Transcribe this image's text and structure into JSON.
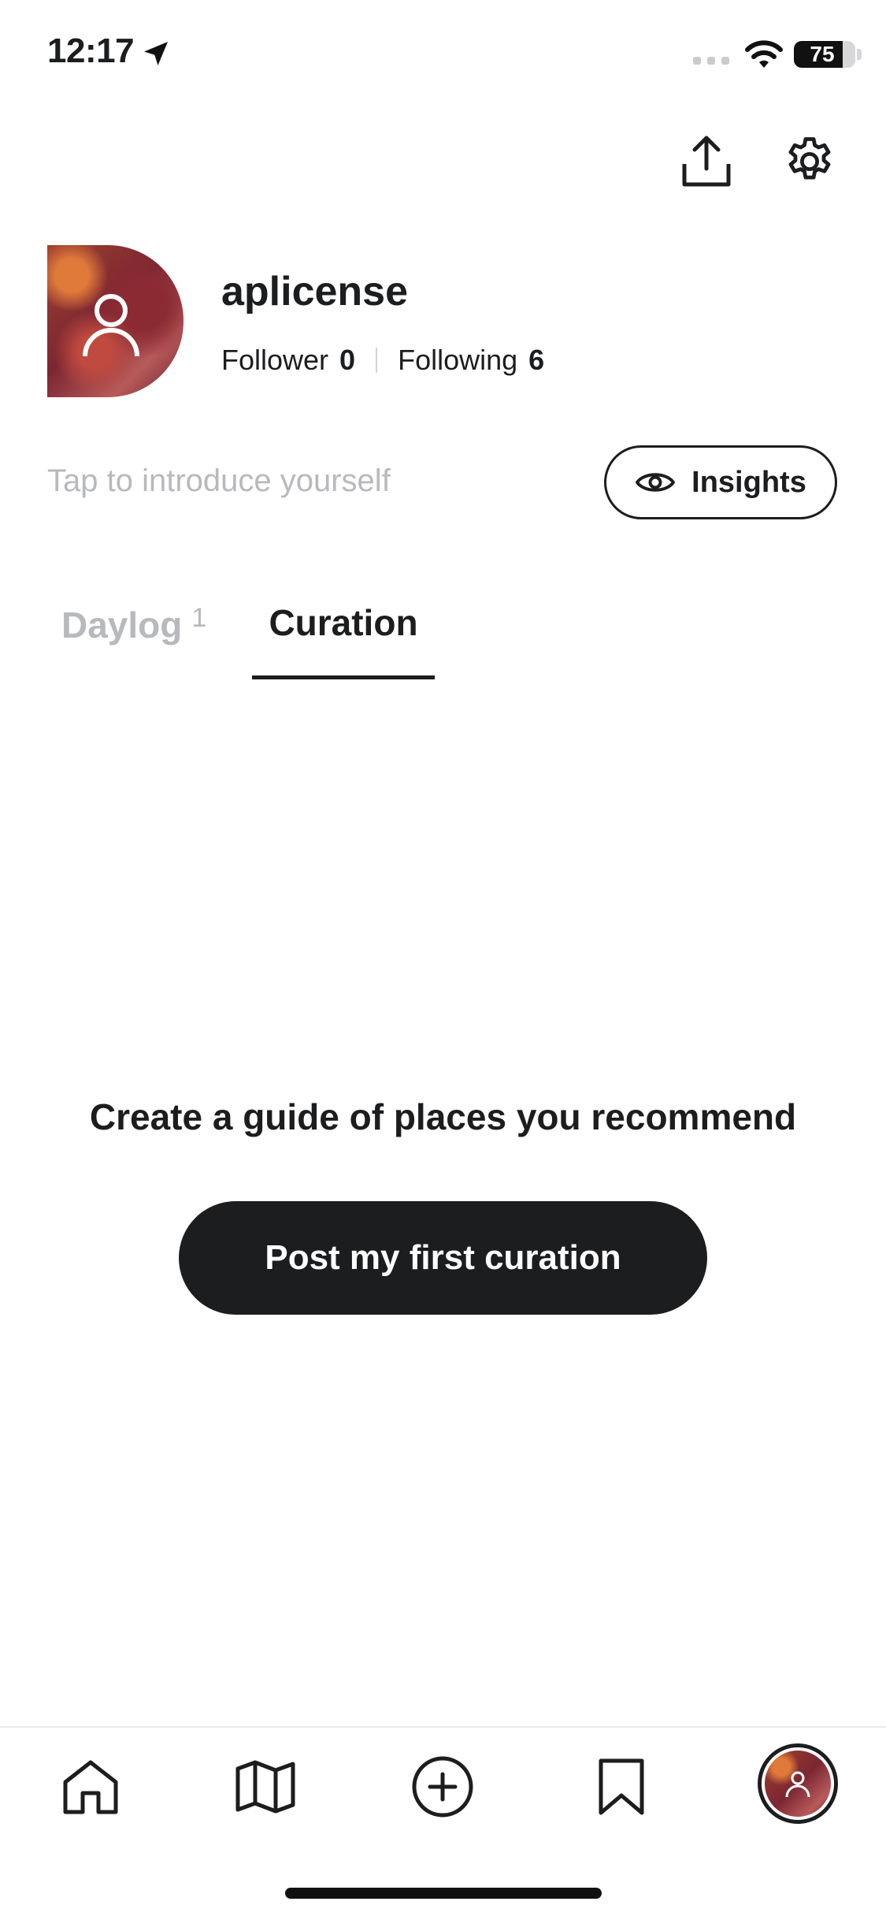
{
  "status_bar": {
    "time": "12:17",
    "battery": "75"
  },
  "header": {
    "share_icon": "share-upload-icon",
    "settings_icon": "gear-icon"
  },
  "profile": {
    "username": "aplicense",
    "follower_label": "Follower",
    "follower_count": "0",
    "following_label": "Following",
    "following_count": "6",
    "intro_placeholder": "Tap to introduce yourself",
    "insights_label": "Insights"
  },
  "tabs": [
    {
      "label": "Daylog",
      "count": "1",
      "active": false
    },
    {
      "label": "Curation",
      "active": true
    }
  ],
  "empty_state": {
    "title": "Create a guide of places you recommend",
    "button_label": "Post my first curation"
  },
  "bottom_nav": {
    "items": [
      "home-icon",
      "map-icon",
      "add-circle-icon",
      "bookmark-icon",
      "profile-avatar"
    ],
    "active": "profile-avatar"
  },
  "colors": {
    "primary": "#1c1d1f",
    "muted": "#b7b9bd",
    "background": "#ffffff"
  }
}
